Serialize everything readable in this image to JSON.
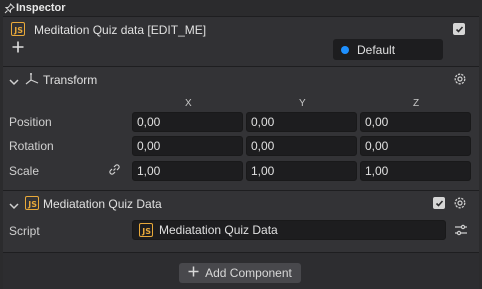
{
  "inspector": {
    "title": "Inspector"
  },
  "object": {
    "name": "Meditation Quiz data [EDIT_ME]",
    "enabled": true,
    "layer": "Default",
    "layer_color": "#1e90ff",
    "add_icon": "plus-icon"
  },
  "transform": {
    "title": "Transform",
    "axes": [
      "X",
      "Y",
      "Z"
    ],
    "rows": [
      {
        "label": "Position",
        "x": "0,00",
        "y": "0,00",
        "z": "0,00"
      },
      {
        "label": "Rotation",
        "x": "0,00",
        "y": "0,00",
        "z": "0,00"
      },
      {
        "label": "Scale",
        "x": "1,00",
        "y": "1,00",
        "z": "1,00"
      }
    ]
  },
  "script_component": {
    "title": "Mediatation Quiz Data",
    "enabled": true,
    "script_label": "Script",
    "script_value": "Mediatation Quiz Data"
  },
  "footer": {
    "add_component_label": "Add Component"
  },
  "colors": {
    "js_icon": "#e8a93a",
    "panel_bg": "#333336",
    "field_bg": "#1d1d1f"
  }
}
